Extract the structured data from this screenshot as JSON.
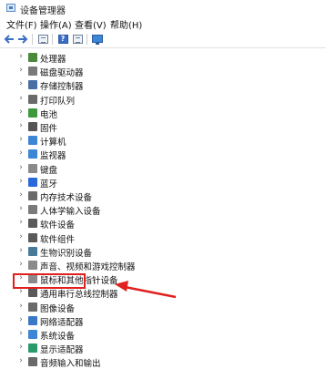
{
  "window": {
    "title": "设备管理器"
  },
  "menu": [
    {
      "label": "文件(F)"
    },
    {
      "label": "操作(A)"
    },
    {
      "label": "查看(V)"
    },
    {
      "label": "帮助(H)"
    }
  ],
  "toolbar": {
    "back_icon": "back-arrow-icon",
    "forward_icon": "forward-arrow-icon",
    "properties_icon": "properties-icon",
    "help_icon": "help-icon",
    "update_icon": "update-driver-icon",
    "monitor_icon": "display-icon",
    "help_glyph": "?"
  },
  "devices": [
    {
      "label": "处理器",
      "icon": "processor-icon",
      "color": "#4a8a3a"
    },
    {
      "label": "磁盘驱动器",
      "icon": "disk-drive-icon",
      "color": "#7a7a7a"
    },
    {
      "label": "存储控制器",
      "icon": "storage-controller-icon",
      "color": "#4a6fa5"
    },
    {
      "label": "打印队列",
      "icon": "printer-icon",
      "color": "#6a6a6a"
    },
    {
      "label": "电池",
      "icon": "battery-icon",
      "color": "#3c9a3c"
    },
    {
      "label": "固件",
      "icon": "firmware-icon",
      "color": "#555555"
    },
    {
      "label": "计算机",
      "icon": "computer-icon",
      "color": "#3d86d6"
    },
    {
      "label": "监视器",
      "icon": "monitor-icon",
      "color": "#3d86d6"
    },
    {
      "label": "键盘",
      "icon": "keyboard-icon",
      "color": "#8a8a8a"
    },
    {
      "label": "蓝牙",
      "icon": "bluetooth-icon",
      "color": "#2a6ad8"
    },
    {
      "label": "内存技术设备",
      "icon": "memory-device-icon",
      "color": "#6a6a6a"
    },
    {
      "label": "人体学输入设备",
      "icon": "hid-icon",
      "color": "#7a7a7a"
    },
    {
      "label": "软件设备",
      "icon": "software-device-icon",
      "color": "#5a5a5a"
    },
    {
      "label": "软件组件",
      "icon": "software-component-icon",
      "color": "#5a5a5a"
    },
    {
      "label": "生物识别设备",
      "icon": "biometric-icon",
      "color": "#4a7a9a"
    },
    {
      "label": "声音、视频和游戏控制器",
      "icon": "sound-icon",
      "color": "#8a8a8a"
    },
    {
      "label": "鼠标和其他指针设备",
      "icon": "mouse-icon",
      "color": "#8a8a8a"
    },
    {
      "label": "通用串行总线控制器",
      "icon": "usb-icon",
      "color": "#5a5a5a"
    },
    {
      "label": "图像设备",
      "icon": "camera-icon",
      "color": "#6a6a6a"
    },
    {
      "label": "网络适配器",
      "icon": "network-adapter-icon",
      "color": "#3a78c8"
    },
    {
      "label": "系统设备",
      "icon": "system-device-icon",
      "color": "#3d86d6"
    },
    {
      "label": "显示适配器",
      "icon": "display-adapter-icon",
      "color": "#2a9a6a"
    },
    {
      "label": "音频输入和输出",
      "icon": "audio-io-icon",
      "color": "#6a6a6a"
    }
  ],
  "annotation": {
    "highlight_color": "#e02020"
  }
}
